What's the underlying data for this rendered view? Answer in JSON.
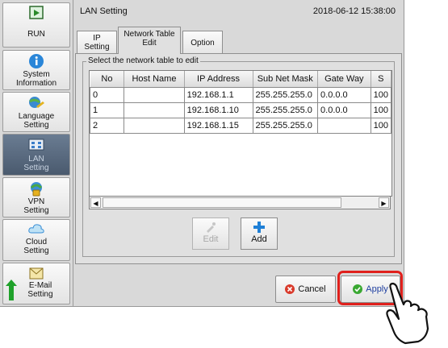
{
  "header": {
    "title": "LAN Setting",
    "datetime": "2018-06-12 15:38:00"
  },
  "sidebar": {
    "items": [
      {
        "label": "RUN",
        "icon": "run-icon",
        "active": false
      },
      {
        "label": "System Information",
        "label_lines": [
          "System",
          "Information"
        ],
        "icon": "info-icon",
        "active": false
      },
      {
        "label": "Language Setting",
        "label_lines": [
          "Language",
          "Setting"
        ],
        "icon": "language-icon",
        "active": false
      },
      {
        "label": "LAN Setting",
        "label_lines": [
          "LAN",
          "Setting"
        ],
        "icon": "lan-icon",
        "active": true
      },
      {
        "label": "VPN Setting",
        "label_lines": [
          "VPN",
          "Setting"
        ],
        "icon": "vpn-icon",
        "active": false
      },
      {
        "label": "Cloud Setting",
        "label_lines": [
          "Cloud",
          "Setting"
        ],
        "icon": "cloud-icon",
        "active": false
      },
      {
        "label": "E-Mail Setting",
        "label_lines": [
          "E-Mail",
          "Setting"
        ],
        "icon": "mail-icon",
        "active": false
      }
    ]
  },
  "tabs": [
    {
      "label_lines": [
        "IP",
        "Setting"
      ],
      "active": false
    },
    {
      "label_lines": [
        "Network Table",
        "Edit"
      ],
      "active": true
    },
    {
      "label_lines": [
        "Option"
      ],
      "active": false
    }
  ],
  "group": {
    "legend": "Select the network table to edit"
  },
  "table": {
    "columns": [
      "No",
      "Host Name",
      "IP Address",
      "Sub Net Mask",
      "Gate Way",
      "S"
    ],
    "rows": [
      [
        "0",
        "",
        "192.168.1.1",
        "255.255.255.0",
        "0.0.0.0",
        "100"
      ],
      [
        "1",
        "",
        "192.168.1.10",
        "255.255.255.0",
        "0.0.0.0",
        "100"
      ],
      [
        "2",
        "",
        "192.168.1.15",
        "255.255.255.0",
        "",
        "100"
      ]
    ]
  },
  "buttons": {
    "edit": "Edit",
    "add": "Add",
    "cancel": "Cancel",
    "apply": "Apply"
  },
  "colors": {
    "accent": "#e0201c",
    "active_nav": "#5a6a80",
    "add_icon": "#1e7fd6",
    "cancel_icon": "#d93a2b",
    "apply_icon": "#3aa832"
  }
}
